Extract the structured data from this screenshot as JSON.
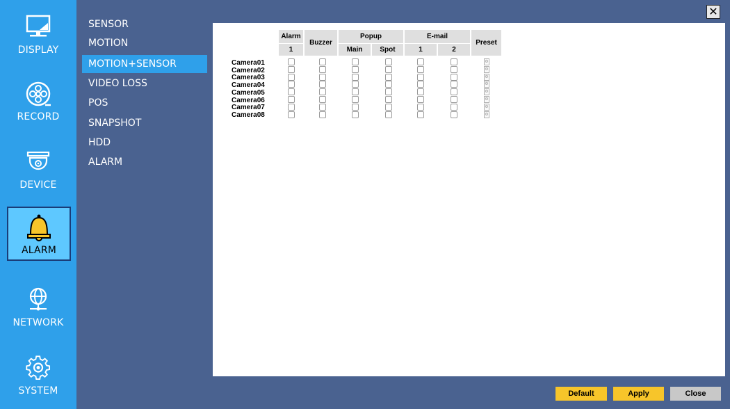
{
  "sidebar": {
    "items": [
      {
        "label": "DISPLAY",
        "icon": "monitor-icon"
      },
      {
        "label": "RECORD",
        "icon": "film-reel-icon"
      },
      {
        "label": "DEVICE",
        "icon": "dome-camera-icon"
      },
      {
        "label": "ALARM",
        "icon": "bell-icon"
      },
      {
        "label": "NETWORK",
        "icon": "globe-network-icon"
      },
      {
        "label": "SYSTEM",
        "icon": "gear-icon"
      }
    ],
    "active": "ALARM"
  },
  "submenu": {
    "items": [
      "SENSOR",
      "MOTION",
      "MOTION+SENSOR",
      "VIDEO LOSS",
      "POS",
      "SNAPSHOT",
      "HDD",
      "ALARM"
    ],
    "active": "MOTION+SENSOR"
  },
  "table": {
    "headers": {
      "alarm": "Alarm",
      "alarm_1": "1",
      "buzzer": "Buzzer",
      "popup": "Popup",
      "popup_main": "Main",
      "popup_spot": "Spot",
      "email": "E-mail",
      "email_1": "1",
      "email_2": "2",
      "preset": "Preset"
    },
    "cameras": [
      "Camera01",
      "Camera02",
      "Camera03",
      "Camera04",
      "Camera05",
      "Camera06",
      "Camera07",
      "Camera08"
    ]
  },
  "buttons": {
    "default": "Default",
    "apply": "Apply",
    "close": "Close",
    "close_x": "✕"
  },
  "colors": {
    "background": "#4a6290",
    "sidebar": "#2fa0ea",
    "active_item": "#5ec8ff",
    "button_yellow": "#f7c52a",
    "button_gray": "#c8c8c8"
  }
}
